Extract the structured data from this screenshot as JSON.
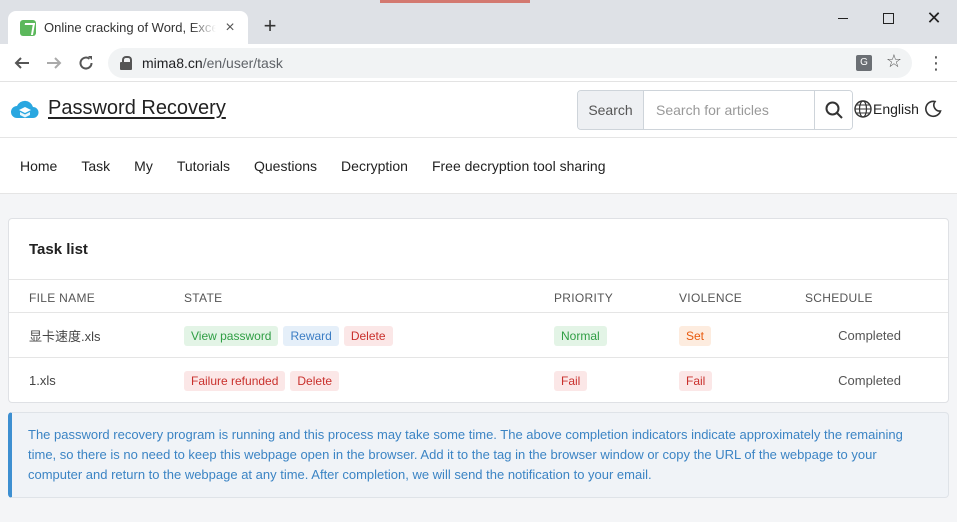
{
  "browser": {
    "tab_title": "Online cracking of Word, Excel",
    "url_host": "mima8.cn",
    "url_path": "/en/user/task"
  },
  "site": {
    "brand": "Password Recovery",
    "search_label": "Search",
    "search_placeholder": "Search for articles",
    "language": "English"
  },
  "nav": [
    "Home",
    "Task",
    "My",
    "Tutorials",
    "Questions",
    "Decryption",
    "Free decryption tool sharing"
  ],
  "task_card": {
    "title": "Task list",
    "columns": [
      "FILE NAME",
      "STATE",
      "PRIORITY",
      "VIOLENCE",
      "SCHEDULE"
    ],
    "rows": [
      {
        "file": "显卡速度.xls",
        "states": [
          {
            "label": "View password",
            "tone": "green"
          },
          {
            "label": "Reward",
            "tone": "blue"
          },
          {
            "label": "Delete",
            "tone": "red"
          }
        ],
        "priority": {
          "label": "Normal",
          "tone": "green"
        },
        "violence": {
          "label": "Set",
          "tone": "orange"
        },
        "schedule": "Completed"
      },
      {
        "file": "1.xls",
        "states": [
          {
            "label": "Failure refunded",
            "tone": "red"
          },
          {
            "label": "Delete",
            "tone": "red"
          }
        ],
        "priority": {
          "label": "Fail",
          "tone": "red"
        },
        "violence": {
          "label": "Fail",
          "tone": "red"
        },
        "schedule": "Completed"
      }
    ]
  },
  "notice": "The password recovery program is running and this process may take some time. The above completion indicators indicate approximately the remaining time, so there is no need to keep this webpage open in the browser. Add it to the tag in the browser window or copy the URL of the webpage to your computer and return to the webpage at any time. After completion, we will send the notification to your email.",
  "colors": {
    "accent": "#3d8fd1",
    "green": "#2f9e44",
    "blue": "#3b7dc4",
    "red": "#c9302c",
    "orange": "#e8590c"
  },
  "icons": [
    "favicon-icon",
    "close-icon",
    "plus-icon",
    "back-arrow-icon",
    "forward-arrow-icon",
    "reload-icon",
    "lock-icon",
    "translate-icon",
    "star-icon",
    "kebab-menu-icon",
    "cloud-logo-icon",
    "search-icon",
    "globe-icon",
    "moon-icon"
  ]
}
